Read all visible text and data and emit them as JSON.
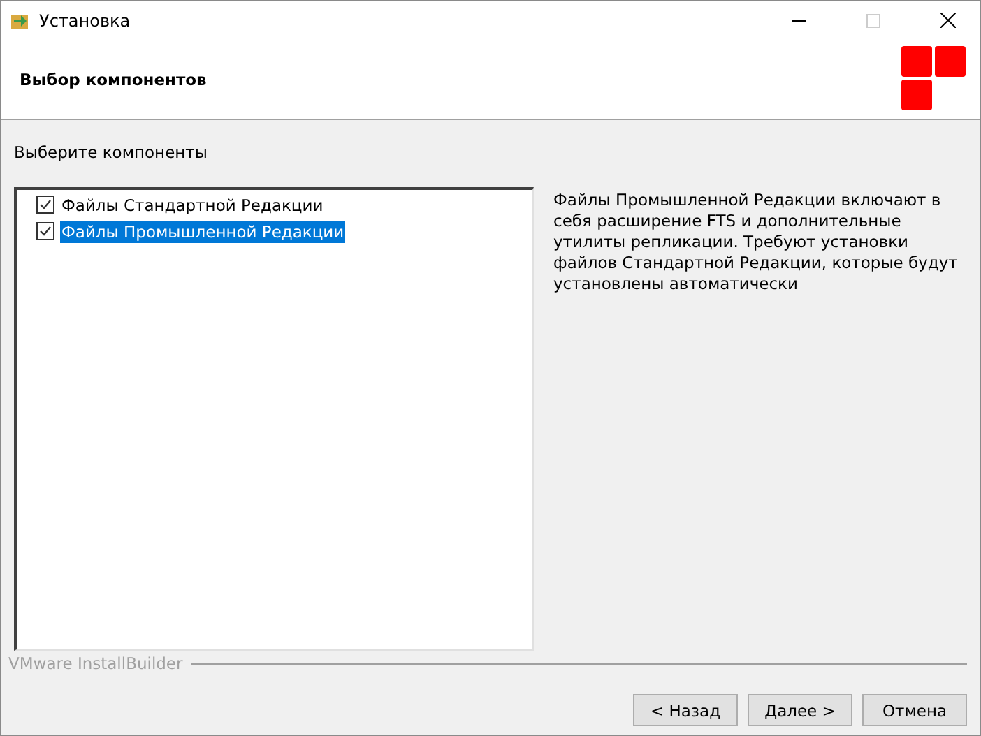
{
  "window": {
    "title": "Установка"
  },
  "header": {
    "title": "Выбор компонентов"
  },
  "prompt": "Выберите компоненты",
  "components": [
    {
      "label": "Файлы Стандартной Редакции",
      "checked": true,
      "selected": false
    },
    {
      "label": "Файлы Промышленной Редакции",
      "checked": true,
      "selected": true
    }
  ],
  "description": "Файлы Промышленной Редакции включают в себя расширение FTS и дополнительные утилиты репликации. Требуют установки файлов Стандартной Редакции, которые будут установлены автоматически",
  "branding": "VMware InstallBuilder",
  "buttons": [
    "< Назад",
    "Далее >",
    "Отмена"
  ]
}
